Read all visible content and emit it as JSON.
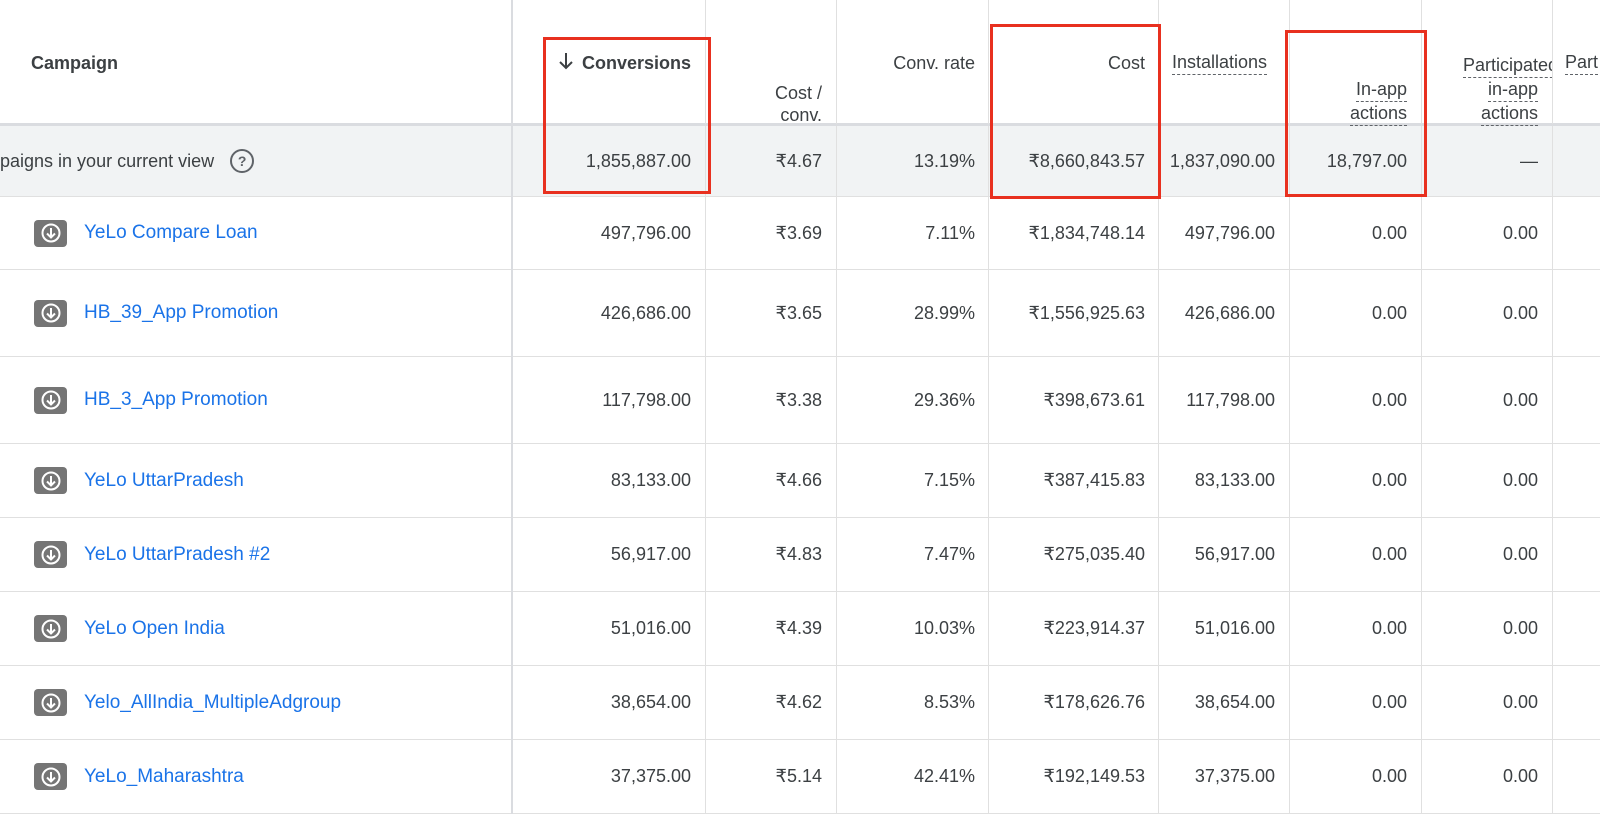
{
  "header": {
    "campaign": "Campaign",
    "conversions": "Conversions",
    "cost_conv_l1": "Cost /",
    "cost_conv_l2": "conv.",
    "conv_rate": "Conv. rate",
    "cost": "Cost",
    "installations": "Installations",
    "inapp_l1": "In-app",
    "inapp_l2": "actions",
    "part_l1": "Participated",
    "part_l2": "in-app",
    "part_l3": "actions",
    "part2": "Part"
  },
  "total": {
    "label": "paigns in your current view",
    "conversions": "1,855,887.00",
    "cost_conv": "₹4.67",
    "conv_rate": "13.19%",
    "cost": "₹8,660,843.57",
    "installations": "1,837,090.00",
    "inapp": "18,797.00",
    "participated": "—"
  },
  "rows": [
    {
      "name": "YeLo Compare Loan",
      "conversions": "497,796.00",
      "cost_conv": "₹3.69",
      "conv_rate": "7.11%",
      "cost": "₹1,834,748.14",
      "installations": "497,796.00",
      "inapp": "0.00",
      "participated": "0.00"
    },
    {
      "name": "HB_39_App Promotion",
      "conversions": "426,686.00",
      "cost_conv": "₹3.65",
      "conv_rate": "28.99%",
      "cost": "₹1,556,925.63",
      "installations": "426,686.00",
      "inapp": "0.00",
      "participated": "0.00"
    },
    {
      "name": "HB_3_App Promotion",
      "conversions": "117,798.00",
      "cost_conv": "₹3.38",
      "conv_rate": "29.36%",
      "cost": "₹398,673.61",
      "installations": "117,798.00",
      "inapp": "0.00",
      "participated": "0.00"
    },
    {
      "name": "YeLo UttarPradesh",
      "conversions": "83,133.00",
      "cost_conv": "₹4.66",
      "conv_rate": "7.15%",
      "cost": "₹387,415.83",
      "installations": "83,133.00",
      "inapp": "0.00",
      "participated": "0.00"
    },
    {
      "name": "YeLo UttarPradesh #2",
      "conversions": "56,917.00",
      "cost_conv": "₹4.83",
      "conv_rate": "7.47%",
      "cost": "₹275,035.40",
      "installations": "56,917.00",
      "inapp": "0.00",
      "participated": "0.00"
    },
    {
      "name": "YeLo Open India",
      "conversions": "51,016.00",
      "cost_conv": "₹4.39",
      "conv_rate": "10.03%",
      "cost": "₹223,914.37",
      "installations": "51,016.00",
      "inapp": "0.00",
      "participated": "0.00"
    },
    {
      "name": "Yelo_AllIndia_MultipleAdgroup",
      "conversions": "38,654.00",
      "cost_conv": "₹4.62",
      "conv_rate": "8.53%",
      "cost": "₹178,626.76",
      "installations": "38,654.00",
      "inapp": "0.00",
      "participated": "0.00"
    },
    {
      "name": "YeLo_Maharashtra",
      "conversions": "37,375.00",
      "cost_conv": "₹5.14",
      "conv_rate": "42.41%",
      "cost": "₹192,149.53",
      "installations": "37,375.00",
      "inapp": "0.00",
      "participated": "0.00"
    }
  ],
  "colors": {
    "highlight": "#e8301f",
    "link": "#1a73e8"
  },
  "icons": {
    "sort": "arrow-down-icon",
    "download": "download-icon",
    "help": "help-icon"
  }
}
